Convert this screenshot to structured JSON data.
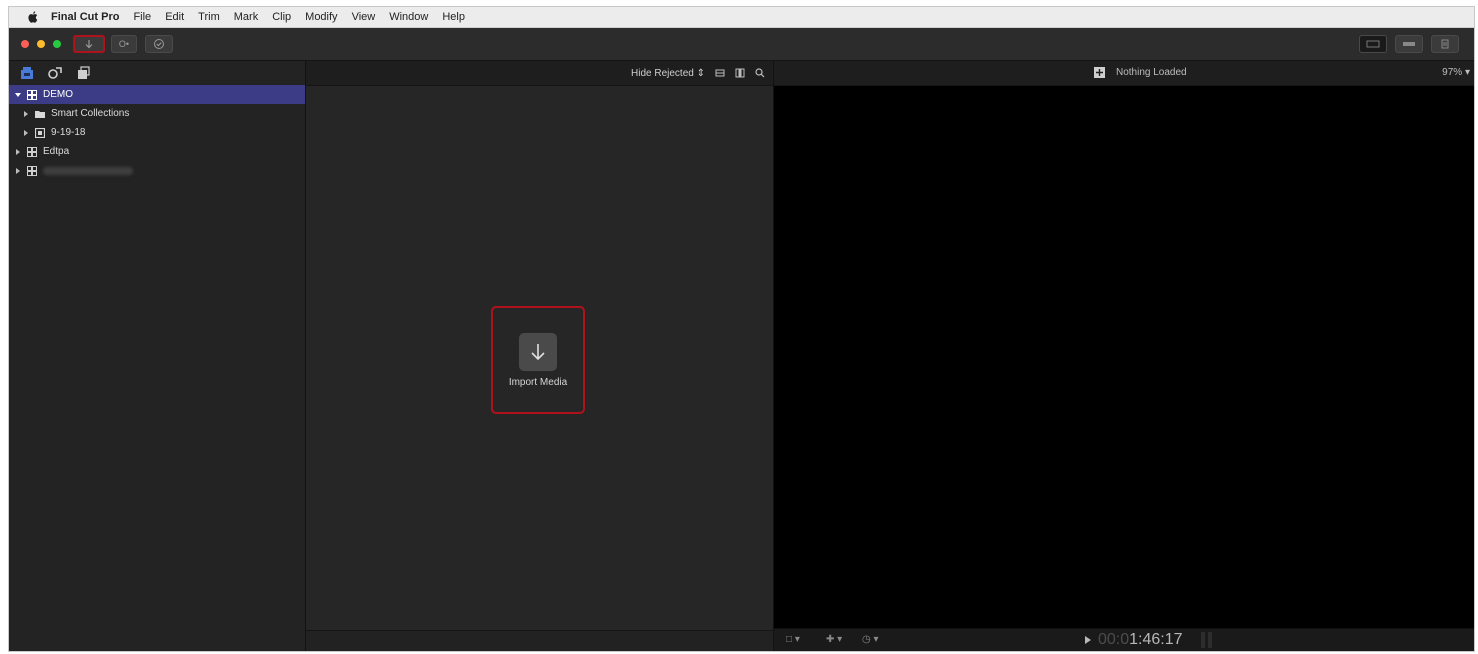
{
  "menubar": {
    "app": "Final Cut Pro",
    "items": [
      "File",
      "Edit",
      "Trim",
      "Mark",
      "Clip",
      "Modify",
      "View",
      "Window",
      "Help"
    ]
  },
  "toolbar": {
    "import_icon": "download-arrow-icon",
    "keyword_label": "O•",
    "check_icon": "checkmark-circle-icon"
  },
  "sidebar": {
    "library": "DEMO",
    "items": [
      {
        "label": "Smart Collections",
        "icon": "folder-icon"
      },
      {
        "label": "9-19-18",
        "icon": "event-icon"
      }
    ],
    "libraries": [
      {
        "label": "Edtpa"
      },
      {
        "label": ""
      }
    ]
  },
  "browser": {
    "filter": "Hide Rejected",
    "import_label": "Import Media"
  },
  "viewer": {
    "status": "Nothing Loaded",
    "zoom": "97%",
    "timecode_dim": "00:0",
    "timecode": "1:46:17"
  },
  "colors": {
    "highlight": "#b0121b",
    "selection": "#3c3c86"
  }
}
